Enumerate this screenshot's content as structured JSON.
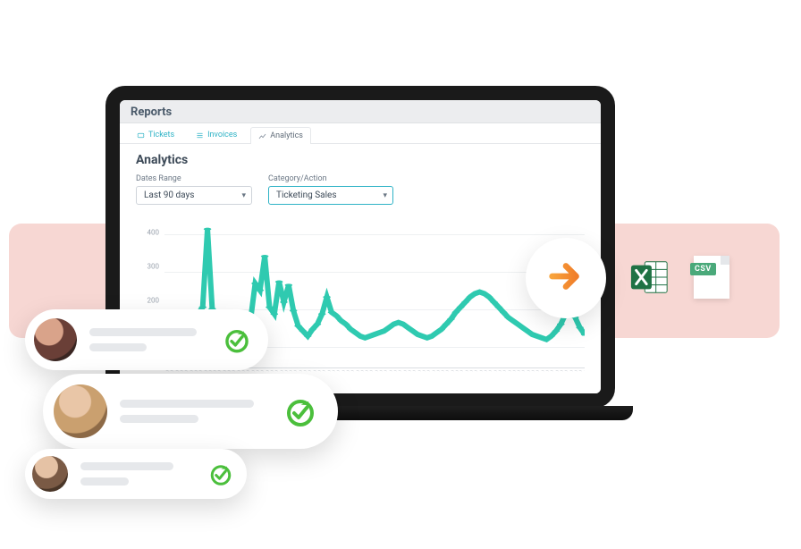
{
  "header": {
    "title": "Reports"
  },
  "tabs": {
    "tickets": "Tickets",
    "invoices": "Invoices",
    "analytics": "Analytics"
  },
  "analytics": {
    "heading": "Analytics",
    "date_label": "Dates Range",
    "date_value": "Last 90 days",
    "cat_label": "Category/Action",
    "cat_value": "Ticketing Sales"
  },
  "export": {
    "csv_badge": "CSV"
  },
  "chart_data": {
    "type": "line",
    "title": "",
    "xlabel": "",
    "ylabel": "",
    "ylim": [
      0,
      450
    ],
    "y_ticks": [
      100,
      200,
      300,
      400
    ],
    "values": [
      110,
      120,
      100,
      95,
      105,
      115,
      130,
      160,
      180,
      410,
      175,
      120,
      100,
      90,
      85,
      95,
      120,
      130,
      140,
      250,
      230,
      330,
      180,
      160,
      255,
      195,
      245,
      170,
      125,
      110,
      95,
      115,
      130,
      160,
      210,
      165,
      155,
      140,
      130,
      115,
      105,
      95,
      90,
      95,
      100,
      105,
      110,
      120,
      130,
      135,
      130,
      120,
      110,
      100,
      95,
      90,
      95,
      105,
      115,
      130,
      145,
      165,
      180,
      195,
      210,
      220,
      225,
      220,
      210,
      195,
      180,
      165,
      150,
      140,
      130,
      120,
      110,
      100,
      95,
      90,
      85,
      95,
      110,
      130,
      160,
      200,
      150,
      120,
      100
    ]
  }
}
